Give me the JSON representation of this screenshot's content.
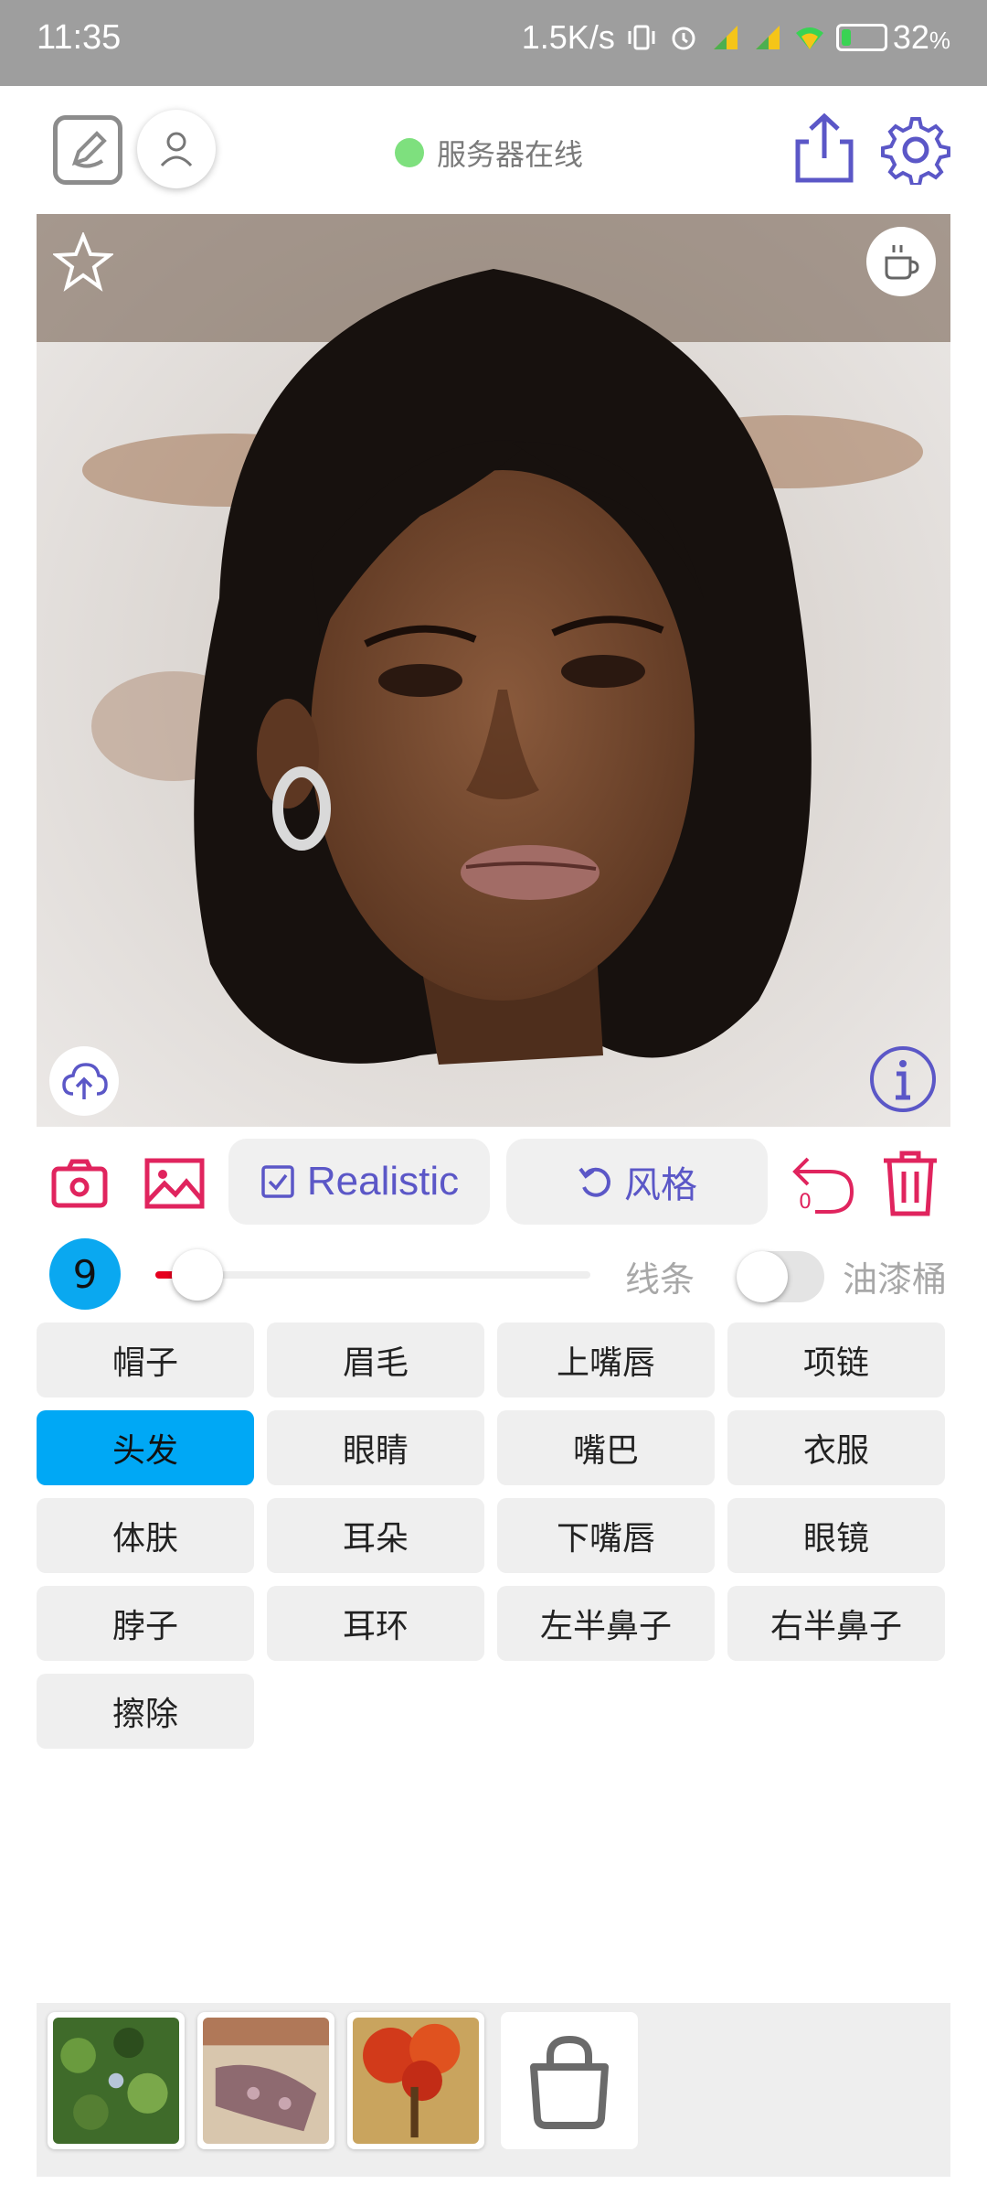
{
  "status_bar": {
    "time": "11:35",
    "network_speed": "1.5K/s",
    "battery_percent": "32",
    "battery_unit": "%",
    "battery_level": 0.32,
    "icons": [
      "vibrate-icon",
      "alarm-icon",
      "signal-hd-icon",
      "signal-hd-icon",
      "wifi-icon",
      "battery-charging-icon"
    ]
  },
  "header": {
    "server_status": "服务器在线",
    "server_status_color": "#7ee07e",
    "accent_color": "#5b57c7"
  },
  "canvas": {
    "image_description": "generated portrait",
    "corner_icons": [
      "star-icon",
      "coffee-cup-icon",
      "cloud-upload-icon",
      "info-icon"
    ]
  },
  "tools": {
    "realistic_label": "Realistic",
    "style_label": "风格",
    "undo_counter": "0",
    "accent_red": "#e0245e"
  },
  "brush": {
    "size": "9",
    "size_fraction": 0.08,
    "line_label": "线条",
    "bucket_label": "油漆桶",
    "bucket_enabled": false
  },
  "parts": [
    {
      "label": "帽子",
      "active": false
    },
    {
      "label": "眉毛",
      "active": false
    },
    {
      "label": "上嘴唇",
      "active": false
    },
    {
      "label": "项链",
      "active": false
    },
    {
      "label": "头发",
      "active": true
    },
    {
      "label": "眼睛",
      "active": false
    },
    {
      "label": "嘴巴",
      "active": false
    },
    {
      "label": "衣服",
      "active": false
    },
    {
      "label": "体肤",
      "active": false
    },
    {
      "label": "耳朵",
      "active": false
    },
    {
      "label": "下嘴唇",
      "active": false
    },
    {
      "label": "眼镜",
      "active": false
    },
    {
      "label": "脖子",
      "active": false
    },
    {
      "label": "耳环",
      "active": false
    },
    {
      "label": "左半鼻子",
      "active": false
    },
    {
      "label": "右半鼻子",
      "active": false
    },
    {
      "label": "擦除",
      "active": false
    }
  ],
  "style_thumbnails": [
    {
      "name": "green-foliage-style"
    },
    {
      "name": "tan-lace-style"
    },
    {
      "name": "red-tree-style"
    }
  ],
  "store_icon": "shopping-bag-icon"
}
